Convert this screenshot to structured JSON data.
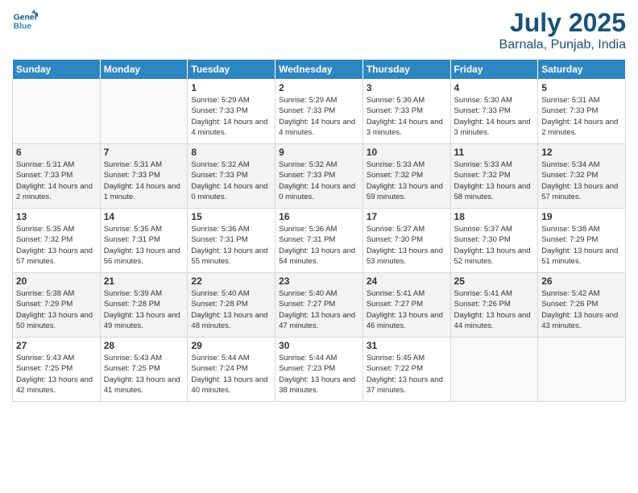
{
  "header": {
    "logo_line1": "General",
    "logo_line2": "Blue",
    "title": "July 2025",
    "location": "Barnala, Punjab, India"
  },
  "weekdays": [
    "Sunday",
    "Monday",
    "Tuesday",
    "Wednesday",
    "Thursday",
    "Friday",
    "Saturday"
  ],
  "weeks": [
    [
      {
        "day": "",
        "info": ""
      },
      {
        "day": "",
        "info": ""
      },
      {
        "day": "1",
        "info": "Sunrise: 5:29 AM\nSunset: 7:33 PM\nDaylight: 14 hours and 4 minutes."
      },
      {
        "day": "2",
        "info": "Sunrise: 5:29 AM\nSunset: 7:33 PM\nDaylight: 14 hours and 4 minutes."
      },
      {
        "day": "3",
        "info": "Sunrise: 5:30 AM\nSunset: 7:33 PM\nDaylight: 14 hours and 3 minutes."
      },
      {
        "day": "4",
        "info": "Sunrise: 5:30 AM\nSunset: 7:33 PM\nDaylight: 14 hours and 3 minutes."
      },
      {
        "day": "5",
        "info": "Sunrise: 5:31 AM\nSunset: 7:33 PM\nDaylight: 14 hours and 2 minutes."
      }
    ],
    [
      {
        "day": "6",
        "info": "Sunrise: 5:31 AM\nSunset: 7:33 PM\nDaylight: 14 hours and 2 minutes."
      },
      {
        "day": "7",
        "info": "Sunrise: 5:31 AM\nSunset: 7:33 PM\nDaylight: 14 hours and 1 minute."
      },
      {
        "day": "8",
        "info": "Sunrise: 5:32 AM\nSunset: 7:33 PM\nDaylight: 14 hours and 0 minutes."
      },
      {
        "day": "9",
        "info": "Sunrise: 5:32 AM\nSunset: 7:33 PM\nDaylight: 14 hours and 0 minutes."
      },
      {
        "day": "10",
        "info": "Sunrise: 5:33 AM\nSunset: 7:32 PM\nDaylight: 13 hours and 59 minutes."
      },
      {
        "day": "11",
        "info": "Sunrise: 5:33 AM\nSunset: 7:32 PM\nDaylight: 13 hours and 58 minutes."
      },
      {
        "day": "12",
        "info": "Sunrise: 5:34 AM\nSunset: 7:32 PM\nDaylight: 13 hours and 57 minutes."
      }
    ],
    [
      {
        "day": "13",
        "info": "Sunrise: 5:35 AM\nSunset: 7:32 PM\nDaylight: 13 hours and 57 minutes."
      },
      {
        "day": "14",
        "info": "Sunrise: 5:35 AM\nSunset: 7:31 PM\nDaylight: 13 hours and 56 minutes."
      },
      {
        "day": "15",
        "info": "Sunrise: 5:36 AM\nSunset: 7:31 PM\nDaylight: 13 hours and 55 minutes."
      },
      {
        "day": "16",
        "info": "Sunrise: 5:36 AM\nSunset: 7:31 PM\nDaylight: 13 hours and 54 minutes."
      },
      {
        "day": "17",
        "info": "Sunrise: 5:37 AM\nSunset: 7:30 PM\nDaylight: 13 hours and 53 minutes."
      },
      {
        "day": "18",
        "info": "Sunrise: 5:37 AM\nSunset: 7:30 PM\nDaylight: 13 hours and 52 minutes."
      },
      {
        "day": "19",
        "info": "Sunrise: 5:38 AM\nSunset: 7:29 PM\nDaylight: 13 hours and 51 minutes."
      }
    ],
    [
      {
        "day": "20",
        "info": "Sunrise: 5:38 AM\nSunset: 7:29 PM\nDaylight: 13 hours and 50 minutes."
      },
      {
        "day": "21",
        "info": "Sunrise: 5:39 AM\nSunset: 7:28 PM\nDaylight: 13 hours and 49 minutes."
      },
      {
        "day": "22",
        "info": "Sunrise: 5:40 AM\nSunset: 7:28 PM\nDaylight: 13 hours and 48 minutes."
      },
      {
        "day": "23",
        "info": "Sunrise: 5:40 AM\nSunset: 7:27 PM\nDaylight: 13 hours and 47 minutes."
      },
      {
        "day": "24",
        "info": "Sunrise: 5:41 AM\nSunset: 7:27 PM\nDaylight: 13 hours and 46 minutes."
      },
      {
        "day": "25",
        "info": "Sunrise: 5:41 AM\nSunset: 7:26 PM\nDaylight: 13 hours and 44 minutes."
      },
      {
        "day": "26",
        "info": "Sunrise: 5:42 AM\nSunset: 7:26 PM\nDaylight: 13 hours and 43 minutes."
      }
    ],
    [
      {
        "day": "27",
        "info": "Sunrise: 5:43 AM\nSunset: 7:25 PM\nDaylight: 13 hours and 42 minutes."
      },
      {
        "day": "28",
        "info": "Sunrise: 5:43 AM\nSunset: 7:25 PM\nDaylight: 13 hours and 41 minutes."
      },
      {
        "day": "29",
        "info": "Sunrise: 5:44 AM\nSunset: 7:24 PM\nDaylight: 13 hours and 40 minutes."
      },
      {
        "day": "30",
        "info": "Sunrise: 5:44 AM\nSunset: 7:23 PM\nDaylight: 13 hours and 38 minutes."
      },
      {
        "day": "31",
        "info": "Sunrise: 5:45 AM\nSunset: 7:22 PM\nDaylight: 13 hours and 37 minutes."
      },
      {
        "day": "",
        "info": ""
      },
      {
        "day": "",
        "info": ""
      }
    ]
  ]
}
